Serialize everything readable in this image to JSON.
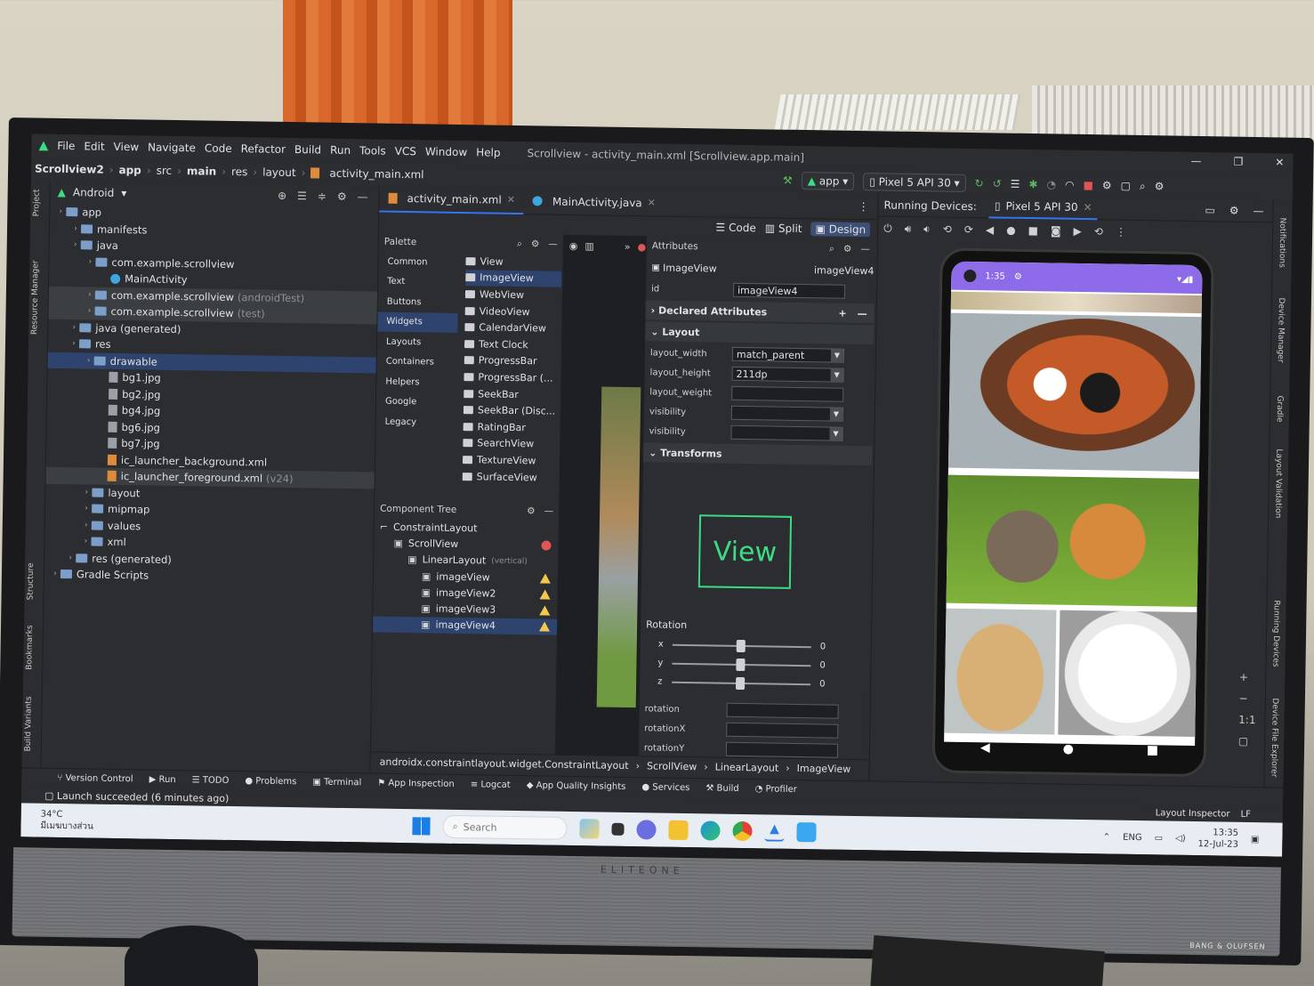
{
  "menu": {
    "items": [
      "File",
      "Edit",
      "View",
      "Navigate",
      "Code",
      "Refactor",
      "Build",
      "Run",
      "Tools",
      "VCS",
      "Window",
      "Help"
    ],
    "title": "Scrollview - activity_main.xml [Scrollview.app.main]"
  },
  "breadcrumb_nav": [
    "Scrollview2",
    "app",
    "src",
    "main",
    "res",
    "layout",
    "activity_main.xml"
  ],
  "run_config": {
    "app": "app",
    "device": "Pixel 5 API 30"
  },
  "project": {
    "view": "Android",
    "tree": [
      {
        "label": "app",
        "depth": 0,
        "type": "folder"
      },
      {
        "label": "manifests",
        "depth": 1,
        "type": "folder"
      },
      {
        "label": "java",
        "depth": 1,
        "type": "folder"
      },
      {
        "label": "com.example.scrollview",
        "depth": 2,
        "type": "folder"
      },
      {
        "label": "MainActivity",
        "depth": 3,
        "type": "kt"
      },
      {
        "label": "com.example.scrollview",
        "suffix": "(androidTest)",
        "depth": 2,
        "type": "folder"
      },
      {
        "label": "com.example.scrollview",
        "suffix": "(test)",
        "depth": 2,
        "type": "folder"
      },
      {
        "label": "java (generated)",
        "depth": 1,
        "type": "folder"
      },
      {
        "label": "res",
        "depth": 1,
        "type": "folder"
      },
      {
        "label": "drawable",
        "depth": 2,
        "type": "folder",
        "selected": true
      },
      {
        "label": "bg1.jpg",
        "depth": 3,
        "type": "img"
      },
      {
        "label": "bg2.jpg",
        "depth": 3,
        "type": "img"
      },
      {
        "label": "bg4.jpg",
        "depth": 3,
        "type": "img"
      },
      {
        "label": "bg6.jpg",
        "depth": 3,
        "type": "img"
      },
      {
        "label": "bg7.jpg",
        "depth": 3,
        "type": "img"
      },
      {
        "label": "ic_launcher_background.xml",
        "depth": 3,
        "type": "xml"
      },
      {
        "label": "ic_launcher_foreground.xml",
        "suffix": "(v24)",
        "depth": 3,
        "type": "xml"
      },
      {
        "label": "layout",
        "depth": 2,
        "type": "folder"
      },
      {
        "label": "mipmap",
        "depth": 2,
        "type": "folder"
      },
      {
        "label": "values",
        "depth": 2,
        "type": "folder"
      },
      {
        "label": "xml",
        "depth": 2,
        "type": "folder"
      },
      {
        "label": "res (generated)",
        "depth": 1,
        "type": "folder"
      },
      {
        "label": "Gradle Scripts",
        "depth": 0,
        "type": "folder"
      }
    ]
  },
  "editor_tabs": [
    "activity_main.xml",
    "MainActivity.java"
  ],
  "modes": {
    "code": "Code",
    "split": "Split",
    "design": "Design"
  },
  "palette": {
    "title": "Palette",
    "categories": [
      "Common",
      "Text",
      "Buttons",
      "Widgets",
      "Layouts",
      "Containers",
      "Helpers",
      "Google",
      "Legacy"
    ],
    "selected_category": "Widgets",
    "items": [
      "View",
      "ImageView",
      "WebView",
      "VideoView",
      "CalendarView",
      "Text Clock",
      "ProgressBar",
      "ProgressBar (...",
      "SeekBar",
      "SeekBar (Disc...",
      "RatingBar",
      "SearchView",
      "TextureView",
      "SurfaceView"
    ]
  },
  "component_tree": {
    "title": "Component Tree",
    "items": [
      {
        "label": "ConstraintLayout",
        "depth": 0
      },
      {
        "label": "ScrollView",
        "depth": 1,
        "status": "error"
      },
      {
        "label": "LinearLayout",
        "suffix": "(vertical)",
        "depth": 2
      },
      {
        "label": "imageView",
        "depth": 3,
        "status": "warning"
      },
      {
        "label": "imageView2",
        "depth": 3,
        "status": "warning"
      },
      {
        "label": "imageView3",
        "depth": 3,
        "status": "warning"
      },
      {
        "label": "imageView4",
        "depth": 3,
        "status": "warning",
        "selected": true
      }
    ]
  },
  "attributes": {
    "title": "Attributes",
    "widget": "ImageView",
    "widget_id": "imageView4",
    "id_label": "id",
    "id_value": "imageView4",
    "declared": "Declared Attributes",
    "layout_section": "Layout",
    "rows": [
      {
        "label": "layout_width",
        "value": "match_parent"
      },
      {
        "label": "layout_height",
        "value": "211dp"
      },
      {
        "label": "layout_weight",
        "value": ""
      },
      {
        "label": "visibility",
        "value": ""
      },
      {
        "label": "visibility",
        "value": ""
      }
    ],
    "transforms": "Transforms",
    "preview_label": "View",
    "rotation_label": "Rotation",
    "rotation_axes": [
      {
        "axis": "x",
        "value": "0"
      },
      {
        "axis": "y",
        "value": "0"
      },
      {
        "axis": "z",
        "value": "0"
      }
    ],
    "rotation_fields": [
      "rotation",
      "rotationX",
      "rotationY"
    ]
  },
  "path_bar": [
    "androidx.constraintlayout.widget.ConstraintLayout",
    "ScrollView",
    "LinearLayout",
    "ImageView"
  ],
  "running_devices": {
    "label": "Running Devices:",
    "device": "Pixel 5 API 30"
  },
  "phone": {
    "time": "1:35"
  },
  "bottom_tools": [
    "Version Control",
    "Run",
    "TODO",
    "Problems",
    "Terminal",
    "App Inspection",
    "Logcat",
    "App Quality Insights",
    "Services",
    "Build",
    "Profiler"
  ],
  "status": {
    "message": "Launch succeeded (6 minutes ago)",
    "right": [
      "Layout Inspector"
    ],
    "encoding": "LF"
  },
  "side_left": [
    "Project",
    "Resource Manager",
    "Structure",
    "Bookmarks",
    "Build Variants"
  ],
  "side_right": [
    "Notifications",
    "Device Manager",
    "Gradle",
    "Layout Validation",
    "Running Devices",
    "Device File Explorer"
  ],
  "taskbar": {
    "weather_temp": "34°C",
    "weather_desc": "มีเมฆบางส่วน",
    "search": "Search",
    "lang": "ENG",
    "time": "13:35",
    "date": "12-Jul-23"
  },
  "monitor": {
    "brand": "ELITEONE",
    "audio": "BANG & OLUFSEN"
  }
}
